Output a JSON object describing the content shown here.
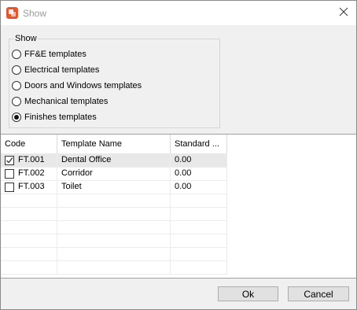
{
  "window": {
    "title": "Show",
    "close_icon": "close-icon",
    "app_icon": "app-icon",
    "app_icon_color": "#e8542c"
  },
  "show_group": {
    "legend": "Show",
    "options": [
      {
        "label": "FF&E templates",
        "checked": false
      },
      {
        "label": "Electrical templates",
        "checked": false
      },
      {
        "label": "Doors and Windows templates",
        "checked": false
      },
      {
        "label": "Mechanical templates",
        "checked": false
      },
      {
        "label": "Finishes templates",
        "checked": true
      }
    ]
  },
  "grid": {
    "columns": [
      "Code",
      "Template Name",
      "Standard ..."
    ],
    "rows": [
      {
        "checked": true,
        "code": "FT.001",
        "name": "Dental Office",
        "standard": "0.00",
        "selected": true
      },
      {
        "checked": false,
        "code": "FT.002",
        "name": "Corridor",
        "standard": "0.00",
        "selected": false
      },
      {
        "checked": false,
        "code": "FT.003",
        "name": "Toilet",
        "standard": "0.00",
        "selected": false
      }
    ]
  },
  "buttons": {
    "ok": "Ok",
    "cancel": "Cancel"
  }
}
